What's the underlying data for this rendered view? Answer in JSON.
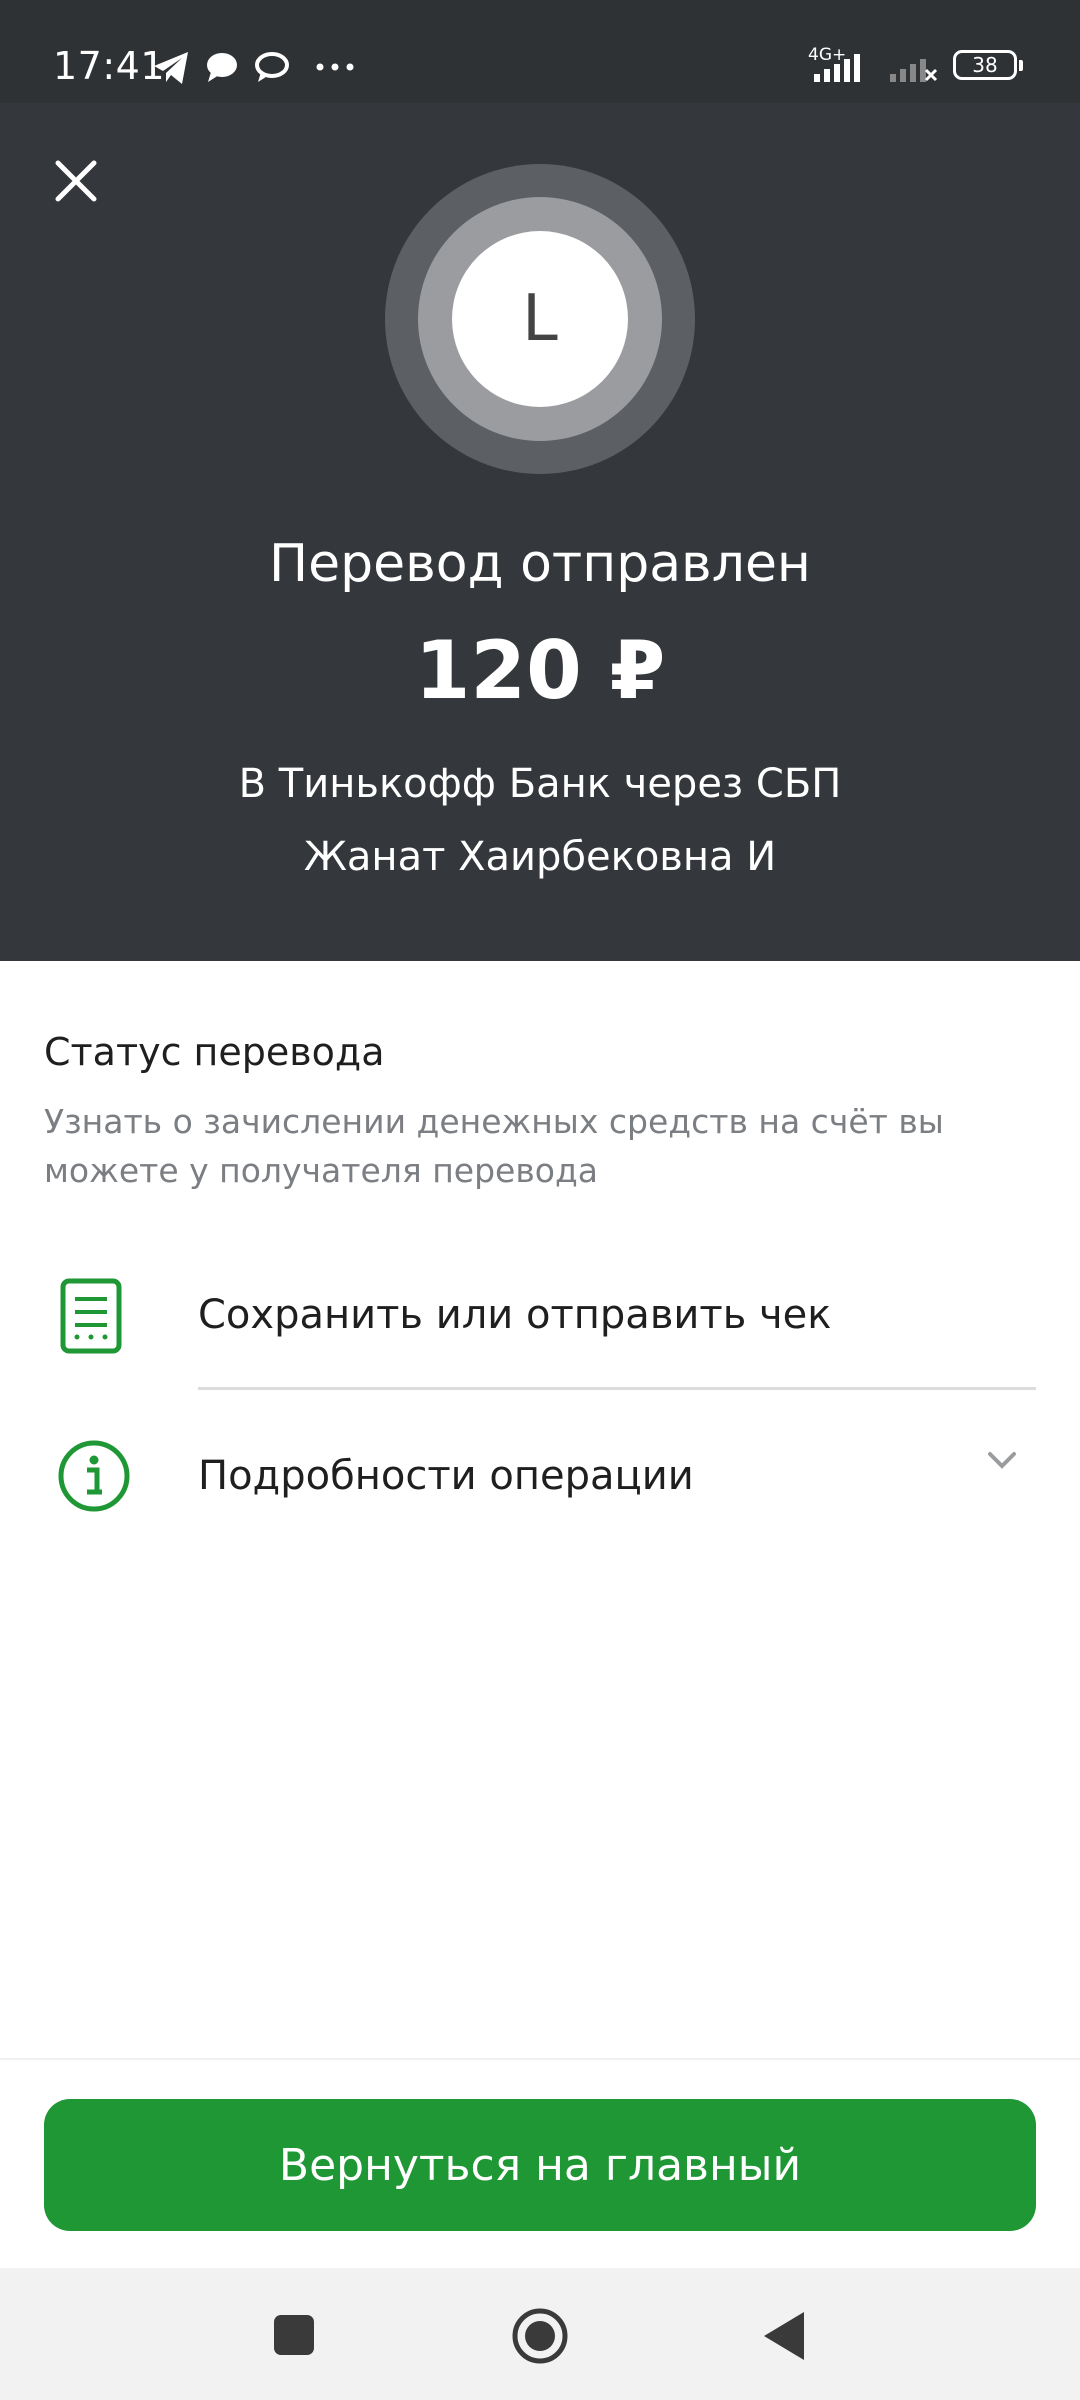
{
  "status_bar": {
    "time": "17:41",
    "network": "4G+",
    "battery": "38",
    "icons": [
      "telegram-icon",
      "chat-icon",
      "chat-icon",
      "more-icon",
      "signal-icon",
      "signal-off-icon",
      "battery-icon"
    ]
  },
  "header": {
    "avatar_letter": "L",
    "title": "Перевод отправлен",
    "amount": "120 ₽",
    "bank_line": "В Тинькофф Банк через СБП",
    "recipient": "Жанат Хаирбековна И"
  },
  "status": {
    "title": "Статус перевода",
    "description": "Узнать о зачислении денежных средств на счёт вы можете у получателя перевода"
  },
  "actions": [
    {
      "label": "Сохранить или отправить чек",
      "icon": "receipt-icon"
    },
    {
      "label": "Подробности операции",
      "icon": "info-icon"
    }
  ],
  "primary_button": {
    "label": "Вернуться на главный"
  },
  "colors": {
    "accent": "#1e9734",
    "header_bg": "#34373b"
  }
}
